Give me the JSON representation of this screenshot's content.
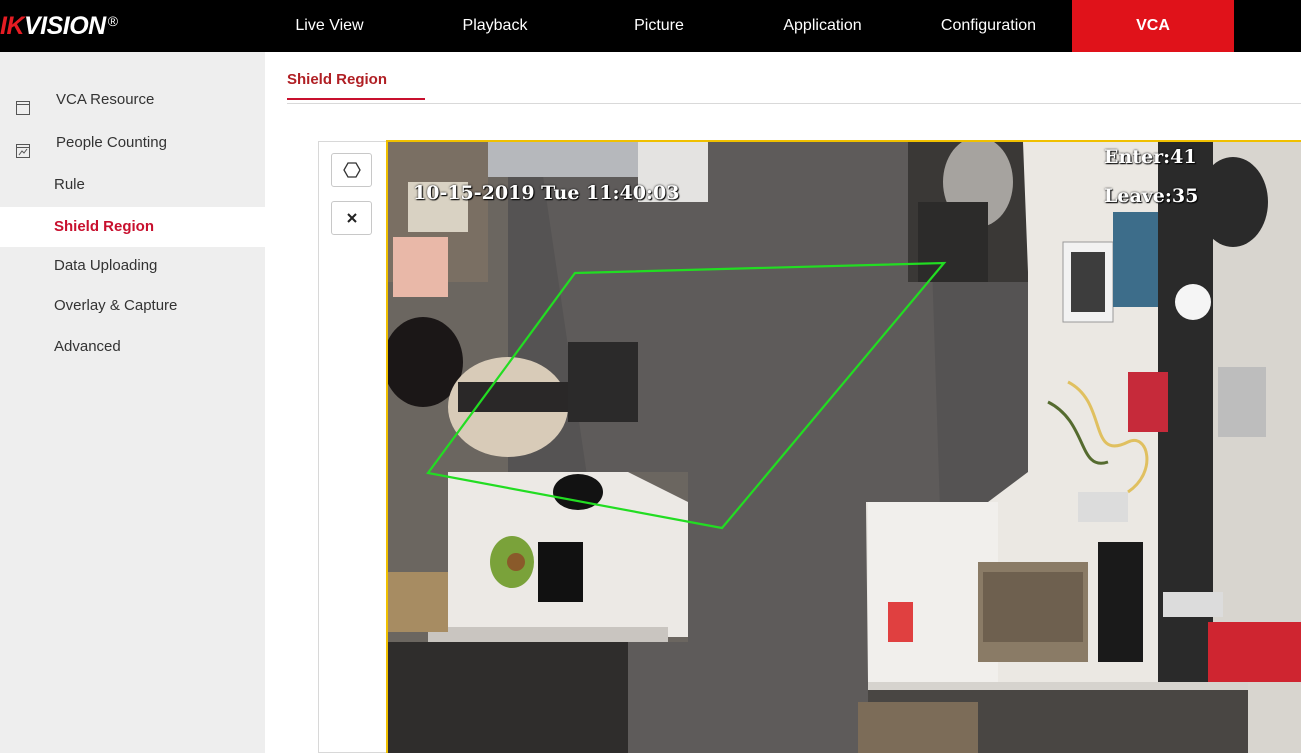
{
  "brand": {
    "logo_red": "IK",
    "logo_white": "VISION",
    "logo_reg": "®"
  },
  "nav": [
    {
      "label": "Live View"
    },
    {
      "label": "Playback"
    },
    {
      "label": "Picture"
    },
    {
      "label": "Application"
    },
    {
      "label": "Configuration"
    },
    {
      "label": "VCA",
      "active": true
    }
  ],
  "sidebar": {
    "items": [
      {
        "label": "VCA Resource",
        "icon": "window-icon"
      },
      {
        "label": "People Counting",
        "icon": "chart-icon"
      },
      {
        "label": "Rule"
      },
      {
        "label": "Shield Region",
        "active": true
      },
      {
        "label": "Data Uploading"
      },
      {
        "label": "Overlay & Capture"
      },
      {
        "label": "Advanced"
      }
    ]
  },
  "tabs": [
    {
      "label": "Shield Region",
      "active": true
    }
  ],
  "toolbar": {
    "draw_icon": "hexagon-icon",
    "clear_icon": "close-icon"
  },
  "video": {
    "timestamp": "10-15-2019 Tue 11:40:03",
    "enter": "Enter:41",
    "leave": "Leave:35"
  },
  "colors": {
    "accent": "#e0121a",
    "active_text": "#c8102e",
    "region_line": "#22dd22",
    "video_border": "#f0c000"
  }
}
